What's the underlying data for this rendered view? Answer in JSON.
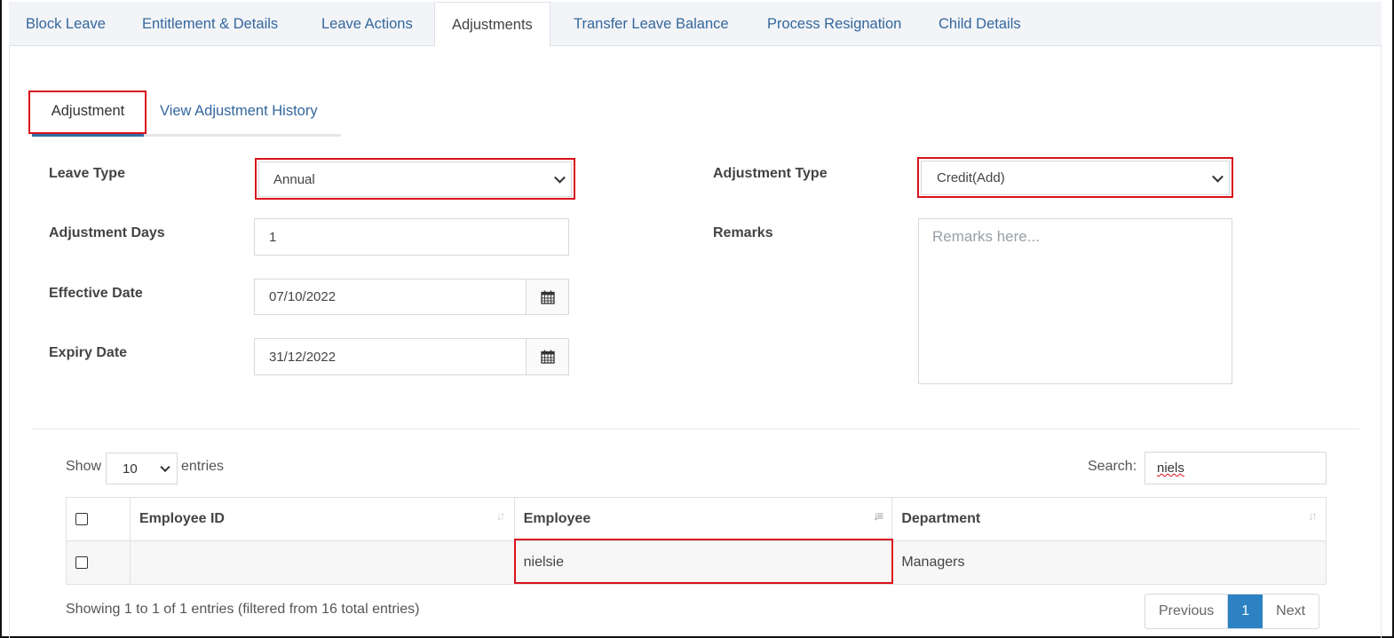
{
  "top_tabs": [
    "Block Leave",
    "Entitlement & Details",
    "Leave Actions",
    "Adjustments",
    "Transfer Leave Balance",
    "Process Resignation",
    "Child Details"
  ],
  "active_top_tab": "Adjustments",
  "sub_tabs": {
    "adjustment": "Adjustment",
    "history": "View Adjustment History"
  },
  "form": {
    "leave_type_label": "Leave Type",
    "leave_type_value": "Annual",
    "adjustment_days_label": "Adjustment Days",
    "adjustment_days_value": "1",
    "effective_date_label": "Effective Date",
    "effective_date_value": "07/10/2022",
    "expiry_date_label": "Expiry Date",
    "expiry_date_value": "31/12/2022",
    "adjustment_type_label": "Adjustment Type",
    "adjustment_type_value": "Credit(Add)",
    "remarks_label": "Remarks",
    "remarks_placeholder": "Remarks here..."
  },
  "table_controls": {
    "show_label": "Show",
    "entries_value": "10",
    "entries_label": "entries",
    "search_label": "Search:",
    "search_value": "niels"
  },
  "table": {
    "headers": [
      "Employee ID",
      "Employee",
      "Department"
    ],
    "rows": [
      {
        "employee_id": "",
        "employee": "nielsie",
        "department": "Managers"
      }
    ]
  },
  "footer": {
    "info": "Showing 1 to 1 of 1 entries (filtered from 16 total entries)",
    "prev": "Previous",
    "page": "1",
    "next": "Next"
  },
  "colors": {
    "highlight": "#d9121c",
    "link": "#34679e",
    "active_page": "#2d82c4"
  }
}
